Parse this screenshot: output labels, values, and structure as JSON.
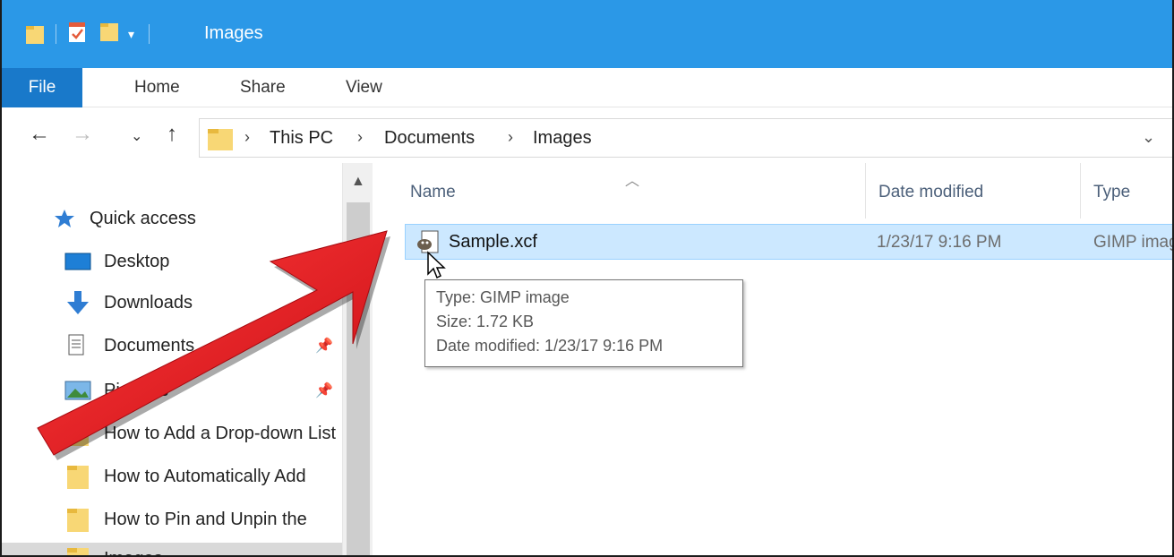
{
  "titlebar": {
    "title": "Images"
  },
  "ribbon": {
    "tabs": [
      "File",
      "Home",
      "Share",
      "View"
    ]
  },
  "address": {
    "crumbs": [
      "This PC",
      "Documents",
      "Images"
    ]
  },
  "nav_pane": {
    "items": [
      {
        "label": "Quick access",
        "icon": "star-icon"
      },
      {
        "label": "Desktop",
        "icon": "desktop-icon"
      },
      {
        "label": "Downloads",
        "icon": "download-icon"
      },
      {
        "label": "Documents",
        "icon": "document-icon"
      },
      {
        "label": "Pictures",
        "icon": "pictures-icon"
      },
      {
        "label": "How to Add a Drop-down List",
        "icon": "folder-icon"
      },
      {
        "label": "How to Automatically Add",
        "icon": "folder-icon"
      },
      {
        "label": "How to Pin and Unpin the",
        "icon": "folder-icon"
      },
      {
        "label": "Images",
        "icon": "folder-icon"
      }
    ]
  },
  "list": {
    "columns": [
      "Name",
      "Date modified",
      "Type"
    ],
    "rows": [
      {
        "name": "Sample.xcf",
        "date": "1/23/17 9:16 PM",
        "type": "GIMP image"
      }
    ]
  },
  "tooltip": {
    "type": "Type: GIMP image",
    "size": "Size: 1.72 KB",
    "date": "Date modified: 1/23/17 9:16 PM"
  },
  "colors": {
    "titlebar": "#2b98e7",
    "file_tab": "#1979ca",
    "selection": "#cce8ff",
    "arrow": "#e8141c"
  }
}
